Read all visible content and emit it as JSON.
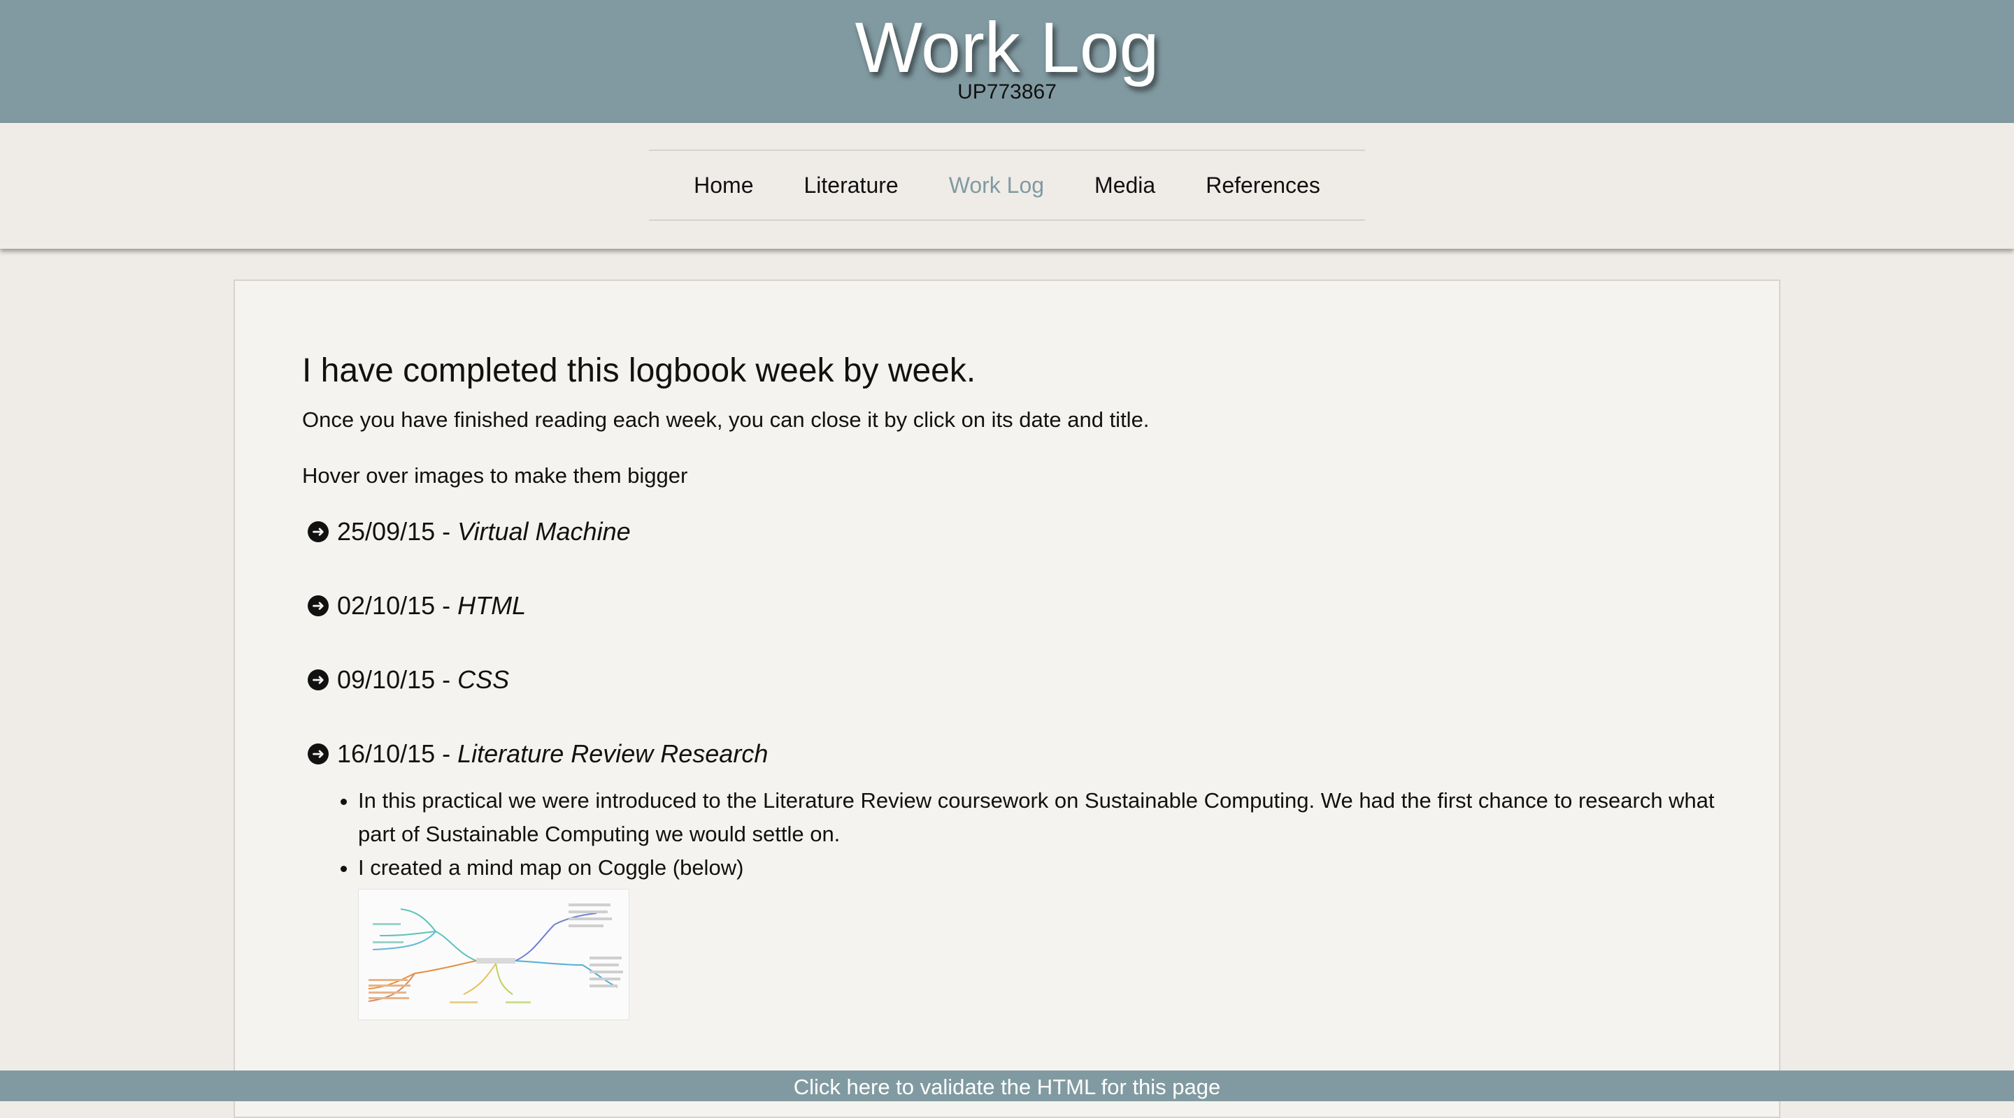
{
  "header": {
    "title": "Work Log",
    "subtitle": "UP773867"
  },
  "nav": {
    "items": [
      {
        "label": "Home"
      },
      {
        "label": "Literature"
      },
      {
        "label": "Work Log"
      },
      {
        "label": "Media"
      },
      {
        "label": "References"
      }
    ],
    "active": "Work Log"
  },
  "main": {
    "heading": "I have completed this logbook week by week.",
    "paragraphs": [
      "Once you have finished reading each week, you can close it by click on its date and title.",
      "Hover over images to make them bigger"
    ],
    "weeks": [
      {
        "date": "25/09/15",
        "separator": "-",
        "title": "Virtual Machine"
      },
      {
        "date": "02/10/15",
        "separator": "-",
        "title": "HTML"
      },
      {
        "date": "09/10/15",
        "separator": "-",
        "title": "CSS"
      },
      {
        "date": "16/10/15",
        "separator": "-",
        "title": "Literature Review Research",
        "bullets": [
          "In this practical we were introduced to the Literature Review coursework on Sustainable Computing. We had the first chance to research what part of Sustainable Computing we would settle on.",
          "I created a mind map on Coggle (below)"
        ]
      }
    ]
  },
  "footer": {
    "validate_label": "Click here to validate the HTML for this page"
  },
  "colors": {
    "header_bg": "#819aa1",
    "page_bg": "#efece8",
    "card_bg": "#f4f3ef",
    "active_nav": "#819aa1"
  },
  "icons": {
    "week_toggle": "arrow-circle-right-icon",
    "mindmap": "mind-map-thumbnail"
  }
}
